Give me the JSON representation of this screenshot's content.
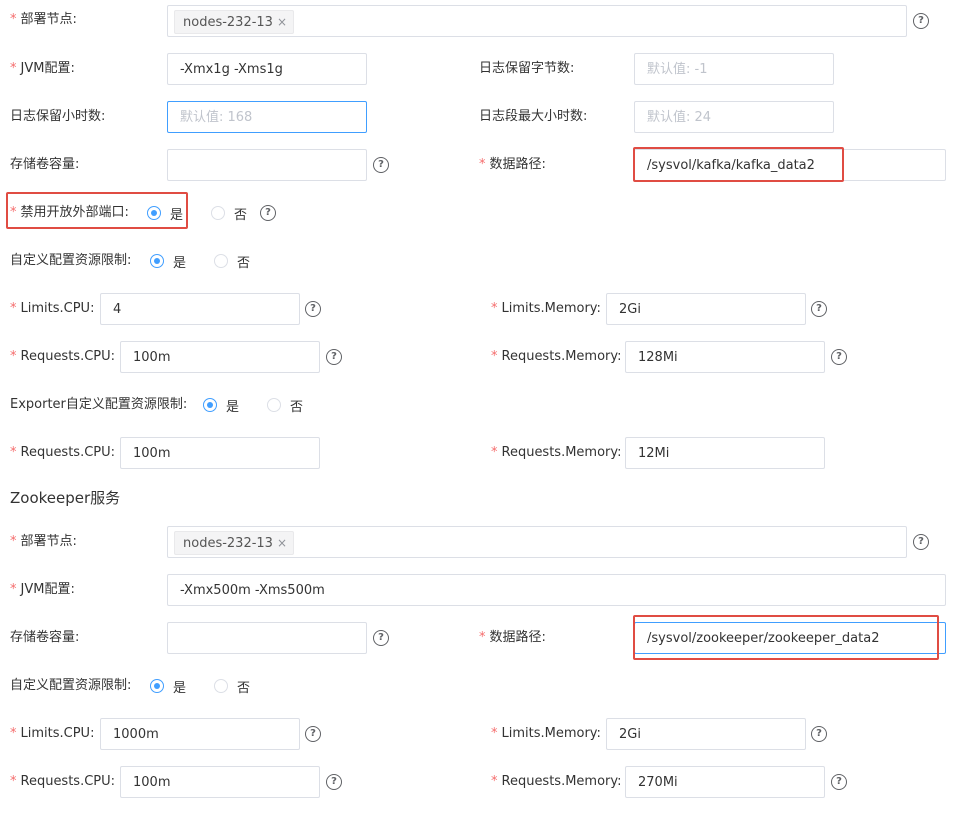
{
  "kafka": {
    "deploy_node_label": "部署节点:",
    "deploy_node_tag": "nodes-232-13",
    "jvm_label": "JVM配置:",
    "jvm_value": "-Xmx1g -Xms1g",
    "log_retention_bytes_label": "日志保留字节数:",
    "log_retention_bytes_placeholder": "默认值: -1",
    "log_retention_hours_label": "日志保留小时数:",
    "log_retention_hours_placeholder": "默认值: 168",
    "log_segment_hours_label": "日志段最大小时数:",
    "log_segment_hours_placeholder": "默认值: 24",
    "storage_label": "存储卷容量:",
    "storage_value": "",
    "data_path_label": "数据路径:",
    "data_path_value": "/sysvol/kafka/kafka_data2",
    "disable_port_label": "禁用开放外部端口:",
    "disable_port_yes": "是",
    "disable_port_no": "否",
    "custom_limit_label": "自定义配置资源限制:",
    "custom_limit_yes": "是",
    "custom_limit_no": "否",
    "limits_cpu_label": "Limits.CPU:",
    "limits_cpu_value": "4",
    "limits_memory_label": "Limits.Memory:",
    "limits_memory_value": "2Gi",
    "requests_cpu_label": "Requests.CPU:",
    "requests_cpu_value": "100m",
    "requests_memory_label": "Requests.Memory:",
    "requests_memory_value": "128Mi",
    "exporter_limit_label": "Exporter自定义配置资源限制:",
    "exporter_limit_yes": "是",
    "exporter_limit_no": "否",
    "exporter_requests_cpu_label": "Requests.CPU:",
    "exporter_requests_cpu_value": "100m",
    "exporter_requests_memory_label": "Requests.Memory:",
    "exporter_requests_memory_value": "12Mi"
  },
  "zookeeper": {
    "section_title": "Zookeeper服务",
    "deploy_node_label": "部署节点:",
    "deploy_node_tag": "nodes-232-13",
    "jvm_label": "JVM配置:",
    "jvm_value": "-Xmx500m -Xms500m",
    "storage_label": "存储卷容量:",
    "storage_value": "",
    "data_path_label": "数据路径:",
    "data_path_value": "/sysvol/zookeeper/zookeeper_data2",
    "custom_limit_label": "自定义配置资源限制:",
    "custom_limit_yes": "是",
    "custom_limit_no": "否",
    "limits_cpu_label": "Limits.CPU:",
    "limits_cpu_value": "1000m",
    "limits_memory_label": "Limits.Memory:",
    "limits_memory_value": "2Gi",
    "requests_cpu_label": "Requests.CPU:",
    "requests_cpu_value": "100m",
    "requests_memory_label": "Requests.Memory:",
    "requests_memory_value": "270Mi"
  },
  "icons": {
    "help": "question-circle-icon",
    "tag_close": "close-icon"
  },
  "colors": {
    "required": "#f56c6c",
    "accent": "#409eff",
    "highlight": "#e04c43"
  },
  "glyphs": {
    "help": "?",
    "close": "×"
  }
}
